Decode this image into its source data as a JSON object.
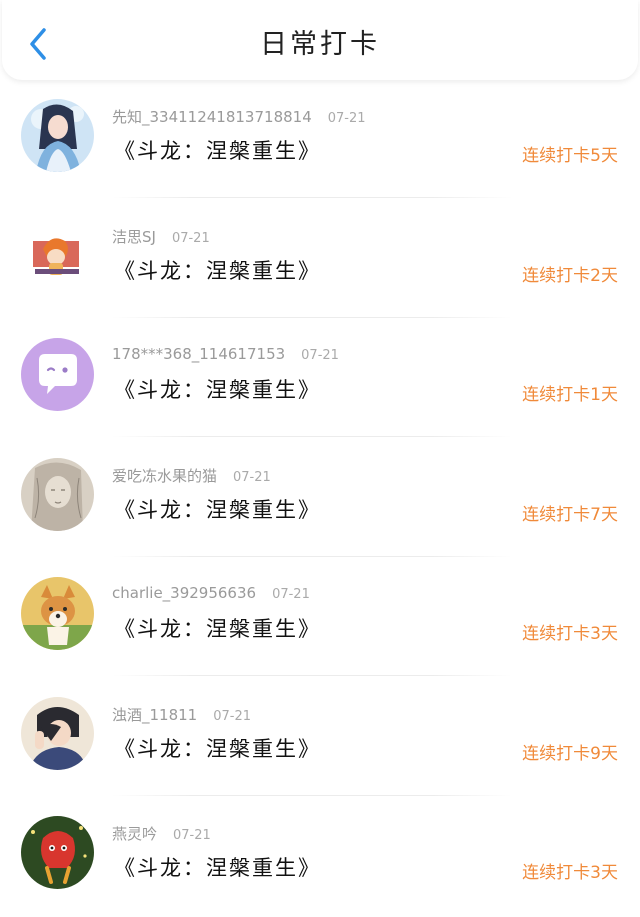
{
  "header": {
    "title": "日常打卡",
    "back_icon": "back-arrow-icon"
  },
  "colors": {
    "accent_back": "#2e8fe6",
    "streak": "#f08a3a"
  },
  "entries": [
    {
      "user": "先知_3341124181371881​4",
      "date": "07-21",
      "book": "《斗龙：涅槃重生》",
      "streak": "连续打卡5天",
      "avatar_icon": "anime-girl-avatar"
    },
    {
      "user": "洁思SJ",
      "date": "07-21",
      "book": "《斗龙：涅槃重生》",
      "streak": "连续打卡2天",
      "avatar_icon": "cartoon-boy-avatar"
    },
    {
      "user": "178***368_114617153",
      "date": "07-21",
      "book": "《斗龙：涅槃重生》",
      "streak": "连续打卡1天",
      "avatar_icon": "chat-bubble-avatar"
    },
    {
      "user": "爱吃冻水果的猫",
      "date": "07-21",
      "book": "《斗龙：涅槃重生》",
      "streak": "连续打卡7天",
      "avatar_icon": "sketch-portrait-avatar"
    },
    {
      "user": "charlie_392956636",
      "date": "07-21",
      "book": "《斗龙：涅槃重生》",
      "streak": "连续打卡3天",
      "avatar_icon": "corgi-dog-avatar"
    },
    {
      "user": "浊酒_11811",
      "date": "07-21",
      "book": "《斗龙：涅槃重生》",
      "streak": "连续打卡9天",
      "avatar_icon": "anime-boy-avatar"
    },
    {
      "user": "燕灵吟",
      "date": "07-21",
      "book": "《斗龙：涅槃重生》",
      "streak": "连续打卡3天",
      "avatar_icon": "red-creature-avatar"
    }
  ]
}
